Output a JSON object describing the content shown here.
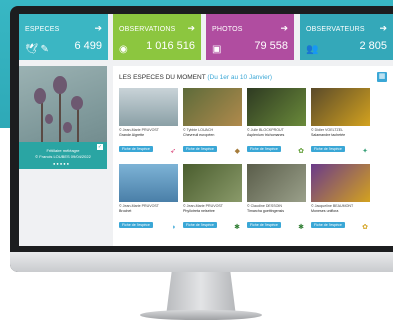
{
  "tiles": [
    {
      "label": "ESPECES",
      "value": "6 499",
      "icon": "bird-icon",
      "color": "#3bb6c3"
    },
    {
      "label": "OBSERVATIONS",
      "value": "1 016 516",
      "icon": "eye-icon",
      "color": "#8cc63f"
    },
    {
      "label": "PHOTOS",
      "value": "79 558",
      "icon": "camera-icon",
      "color": "#b04da0"
    },
    {
      "label": "OBSERVATEURS",
      "value": "2 805",
      "icon": "users-icon",
      "color": "#34a8b9"
    }
  ],
  "featured": {
    "caption_line1": "Fritillaire méléagre",
    "caption_line2": "© Francis LOUBES 09/04/2022"
  },
  "panel": {
    "title": "LES ESPECES DU MOMENT",
    "subtitle": "(Du 1er au 10 Janvier)"
  },
  "species": [
    {
      "author": "© Jean-Marie PRUVOST",
      "name": "Grande Aigrette",
      "button": "Fiche de l'espèce",
      "marker": "bird"
    },
    {
      "author": "© Tybbie LOUACH",
      "name": "Chevreuil européen",
      "button": "Fiche de l'espèce",
      "marker": "mammal"
    },
    {
      "author": "© Julie BLOCKPROUT",
      "name": "Asplenium trichomanes",
      "button": "Fiche de l'espèce",
      "marker": "plant"
    },
    {
      "author": "© Didier VOELTZEL",
      "name": "Salamandre tachetée",
      "button": "Fiche de l'espèce",
      "marker": "amphibian"
    },
    {
      "author": "© Jean-Marie PRUVOST",
      "name": "Brochet",
      "button": "Fiche de l'espèce",
      "marker": "fish"
    },
    {
      "author": "© Jean-Marie PRUVOST",
      "name": "Phyllotreta nelsebre",
      "button": "Fiche de l'espèce",
      "marker": "insect"
    },
    {
      "author": "© Claudine DESSOIN",
      "name": "Timarcha goettingensis",
      "button": "Fiche de l'espèce",
      "marker": "insect"
    },
    {
      "author": "© Jacqueline BEAUMONT",
      "name": "Moneses uniflora",
      "button": "Fiche de l'espèce",
      "marker": "plant"
    }
  ]
}
